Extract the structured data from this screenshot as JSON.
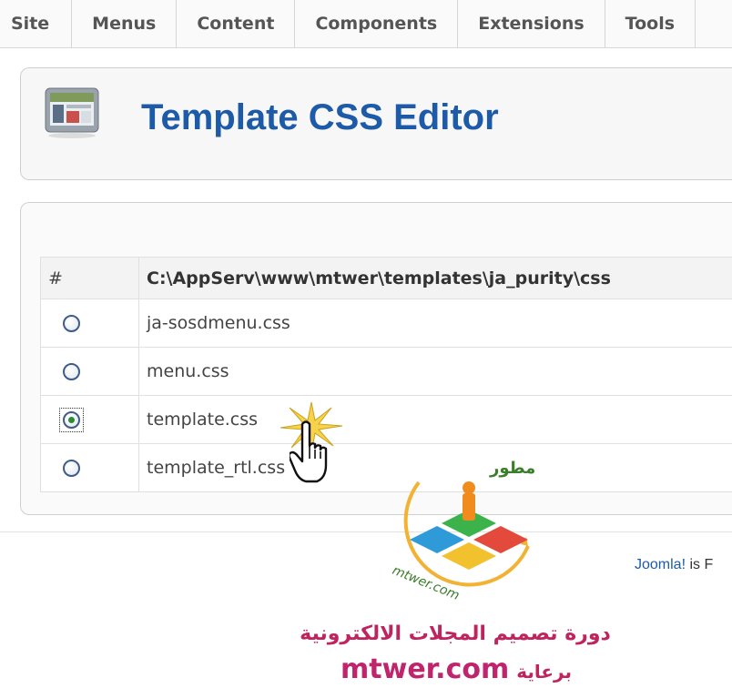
{
  "menubar": {
    "items": [
      {
        "label": "Site"
      },
      {
        "label": "Menus"
      },
      {
        "label": "Content"
      },
      {
        "label": "Components"
      },
      {
        "label": "Extensions"
      },
      {
        "label": "Tools"
      }
    ]
  },
  "header": {
    "title": "Template CSS Editor",
    "icon": "template-screen-icon"
  },
  "file_table": {
    "headers": {
      "hash": "#",
      "path": "C:\\AppServ\\www\\mtwer\\templates\\ja_purity\\css"
    },
    "rows": [
      {
        "file": "ja-sosdmenu.css",
        "selected": false
      },
      {
        "file": "menu.css",
        "selected": false
      },
      {
        "file": "template.css",
        "selected": true
      },
      {
        "file": "template_rtl.css",
        "selected": false
      }
    ]
  },
  "footer": {
    "link": "Joomla!",
    "text": " is F"
  },
  "watermark": {
    "logo_text_top": "مطور",
    "logo_text_bottom": "mtwer.com",
    "line1": "دورة تصميم المجلات الالكترونية",
    "site": "mtwer.com",
    "line2_arabic": "برعاية"
  },
  "colors": {
    "title_blue": "#1d5aa8",
    "watermark_pink": "#c0245f"
  }
}
